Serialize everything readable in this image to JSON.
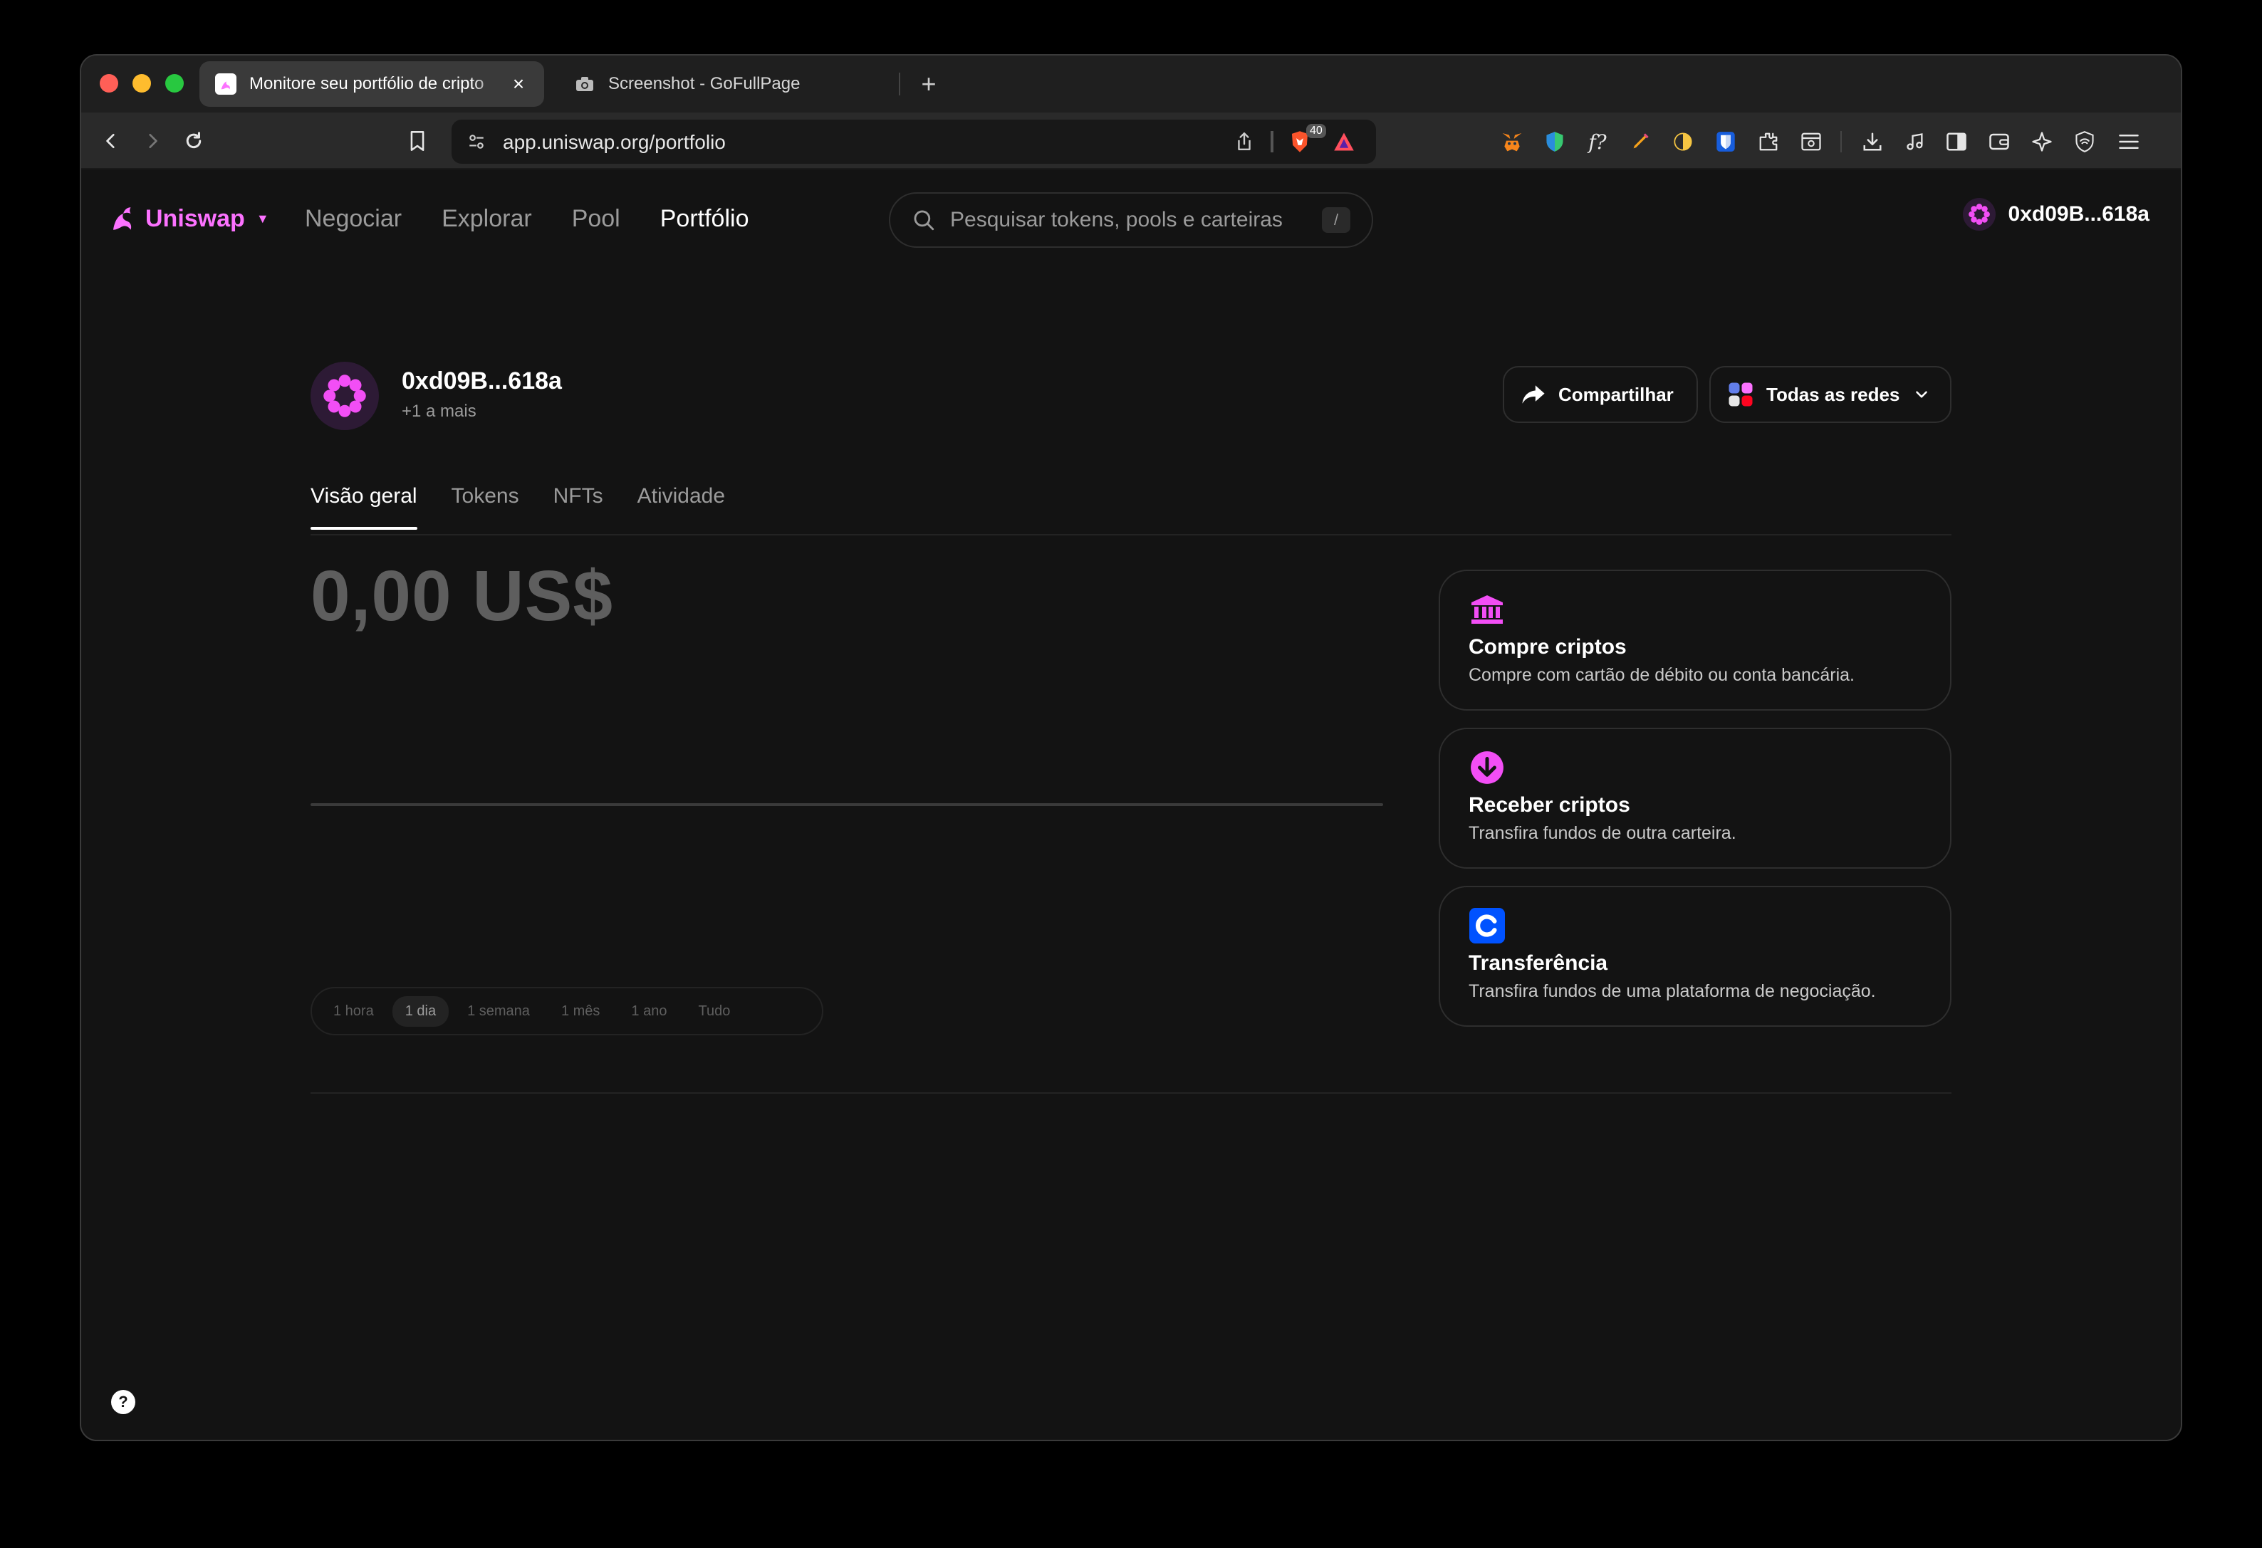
{
  "browser": {
    "tabs": [
      {
        "title": "Monitore seu portfólio de cripto",
        "active": true
      },
      {
        "title": "Screenshot - GoFullPage",
        "active": false
      }
    ],
    "url": "app.uniswap.org/portfolio",
    "brave_shield_count": "40"
  },
  "header": {
    "logo": "Uniswap",
    "nav": [
      "Negociar",
      "Explorar",
      "Pool",
      "Portfólio"
    ],
    "search_placeholder": "Pesquisar tokens, pools e carteiras",
    "search_shortcut": "/",
    "account": "0xd09B...618a"
  },
  "portfolio": {
    "address": "0xd09B...618a",
    "more": "+1 a mais",
    "share_label": "Compartilhar",
    "networks_label": "Todas as redes",
    "tabs": [
      "Visão geral",
      "Tokens",
      "NFTs",
      "Atividade"
    ],
    "balance": "0,00 US$",
    "ranges": [
      "1 hora",
      "1 dia",
      "1 semana",
      "1 mês",
      "1 ano",
      "Tudo"
    ],
    "selected_range": "1 dia"
  },
  "cards": [
    {
      "title": "Compre criptos",
      "desc": "Compre com cartão de débito ou conta bancária."
    },
    {
      "title": "Receber criptos",
      "desc": "Transfira fundos de outra carteira."
    },
    {
      "title": "Transferência",
      "desc": "Transfira fundos de uma plataforma de negociação."
    }
  ],
  "colors": {
    "accent": "#fc72ff",
    "background": "#131313",
    "coinbase": "#0052ff"
  },
  "help_label": "?"
}
